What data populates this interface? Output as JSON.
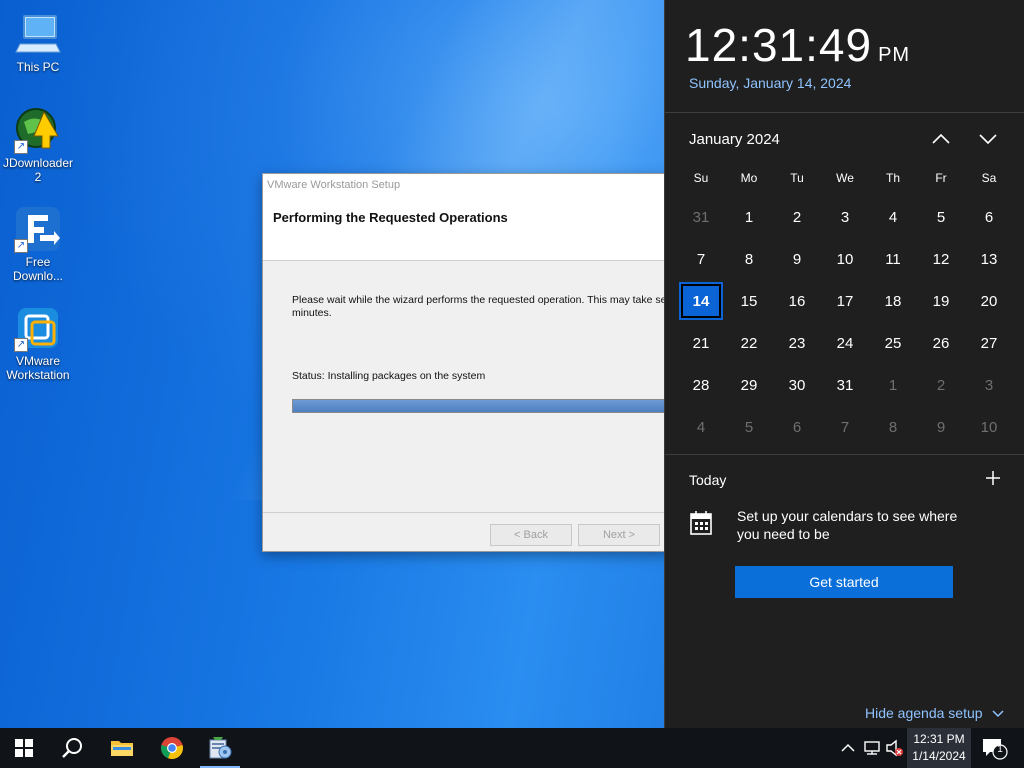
{
  "desktop": {
    "icons": [
      {
        "label": "This PC"
      },
      {
        "label": "JDownloader 2"
      },
      {
        "label": "Free Downlo..."
      },
      {
        "label": "VMware Workstation"
      }
    ]
  },
  "dialog": {
    "title": "VMware Workstation Setup",
    "heading": "Performing the Requested Operations",
    "body": "Please wait while the wizard performs the requested operation. This may take several minutes.",
    "status": "Status: Installing packages on the system",
    "progress_fraction": 0.98,
    "back_label": "< Back",
    "next_label": "Next >"
  },
  "calendar": {
    "time": "12:31:49",
    "ampm": "PM",
    "date_long": "Sunday, January 14, 2024",
    "month_label": "January 2024",
    "weekdays": [
      "Su",
      "Mo",
      "Tu",
      "We",
      "Th",
      "Fr",
      "Sa"
    ],
    "days": [
      {
        "n": "31",
        "dim": true
      },
      {
        "n": "1"
      },
      {
        "n": "2"
      },
      {
        "n": "3"
      },
      {
        "n": "4"
      },
      {
        "n": "5"
      },
      {
        "n": "6"
      },
      {
        "n": "7"
      },
      {
        "n": "8"
      },
      {
        "n": "9"
      },
      {
        "n": "10"
      },
      {
        "n": "11"
      },
      {
        "n": "12"
      },
      {
        "n": "13"
      },
      {
        "n": "14",
        "today": true
      },
      {
        "n": "15"
      },
      {
        "n": "16"
      },
      {
        "n": "17"
      },
      {
        "n": "18"
      },
      {
        "n": "19"
      },
      {
        "n": "20"
      },
      {
        "n": "21"
      },
      {
        "n": "22"
      },
      {
        "n": "23"
      },
      {
        "n": "24"
      },
      {
        "n": "25"
      },
      {
        "n": "26"
      },
      {
        "n": "27"
      },
      {
        "n": "28"
      },
      {
        "n": "29"
      },
      {
        "n": "30"
      },
      {
        "n": "31"
      },
      {
        "n": "1",
        "dim": true
      },
      {
        "n": "2",
        "dim": true
      },
      {
        "n": "3",
        "dim": true
      },
      {
        "n": "4",
        "dim": true
      },
      {
        "n": "5",
        "dim": true
      },
      {
        "n": "6",
        "dim": true
      },
      {
        "n": "7",
        "dim": true
      },
      {
        "n": "8",
        "dim": true
      },
      {
        "n": "9",
        "dim": true
      },
      {
        "n": "10",
        "dim": true
      }
    ],
    "today_label": "Today",
    "agenda_text": "Set up your calendars to see where you need to be",
    "get_started_label": "Get started",
    "hide_agenda_label": "Hide agenda setup"
  },
  "taskbar": {
    "clock_time": "12:31 PM",
    "clock_date": "1/14/2024",
    "notification_count": "1"
  },
  "colors": {
    "accent": "#0a64d6",
    "link": "#8fc3ff",
    "flyout_bg": "#1f1f1f",
    "taskbar_bg": "#101418"
  }
}
